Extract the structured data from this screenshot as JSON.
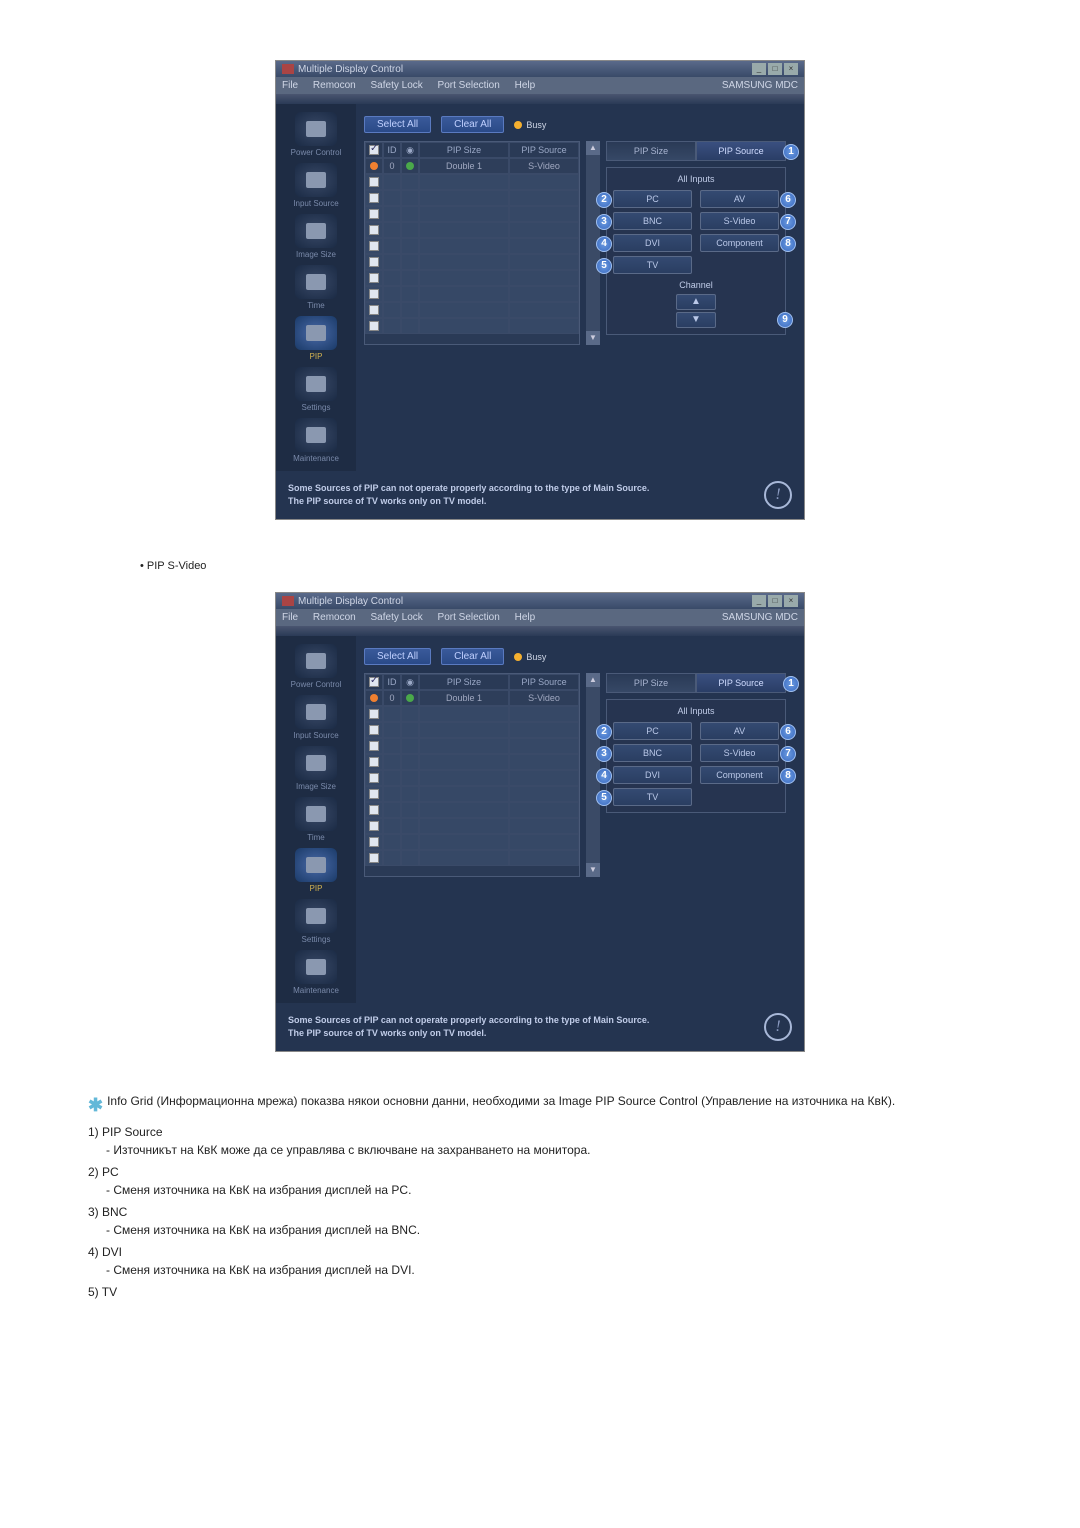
{
  "window": {
    "title": "Multiple Display Control",
    "menus": [
      "File",
      "Remocon",
      "Safety Lock",
      "Port Selection",
      "Help"
    ],
    "brand": "SAMSUNG MDC"
  },
  "actions": {
    "select_all": "Select All",
    "clear_all": "Clear All",
    "busy": "Busy"
  },
  "sidebar": [
    {
      "label": "Power Control"
    },
    {
      "label": "Input Source"
    },
    {
      "label": "Image Size"
    },
    {
      "label": "Time"
    },
    {
      "label": "PIP"
    },
    {
      "label": "Settings"
    },
    {
      "label": "Maintenance"
    }
  ],
  "grid": {
    "headers": {
      "pip_size": "PIP Size",
      "pip_source": "PIP Source"
    },
    "row": {
      "id": "0",
      "size": "Double 1",
      "source": "S-Video"
    }
  },
  "tabs": {
    "size": "PIP Size",
    "source": "PIP Source",
    "badge": "1"
  },
  "inputs": {
    "title": "All Inputs",
    "left": [
      {
        "label": "PC",
        "badge": "2"
      },
      {
        "label": "BNC",
        "badge": "3"
      },
      {
        "label": "DVI",
        "badge": "4"
      },
      {
        "label": "TV",
        "badge": "5"
      }
    ],
    "right": [
      {
        "label": "AV",
        "badge": "6"
      },
      {
        "label": "S-Video",
        "badge": "7"
      },
      {
        "label": "Component",
        "badge": "8"
      }
    ],
    "channel": {
      "title": "Channel",
      "badge": "9"
    }
  },
  "footer": {
    "l1": "Some Sources of PIP can not operate properly according to the type of Main Source.",
    "l2": "The PIP source of TV works only on TV model."
  },
  "caption_1": "• PIP S-Video",
  "notes": {
    "star": "Info Grid (Информационна мрежа) показва някои основни данни, необходими за Image PIP Source Control (Управление на източника на КвК).",
    "items": [
      {
        "num": "1)",
        "title": "PIP Source",
        "desc": "- Източникът на КвК може да се управлява с включване на захранването на монитора."
      },
      {
        "num": "2)",
        "title": "PC",
        "desc": "- Сменя източника на КвК на избрания дисплей на PC."
      },
      {
        "num": "3)",
        "title": "BNC",
        "desc": "- Сменя източника на КвК на избрания дисплей на BNC."
      },
      {
        "num": "4)",
        "title": "DVI",
        "desc": "- Сменя източника на КвК на избрания дисплей на DVI."
      },
      {
        "num": "5)",
        "title": "TV",
        "desc": ""
      }
    ]
  }
}
